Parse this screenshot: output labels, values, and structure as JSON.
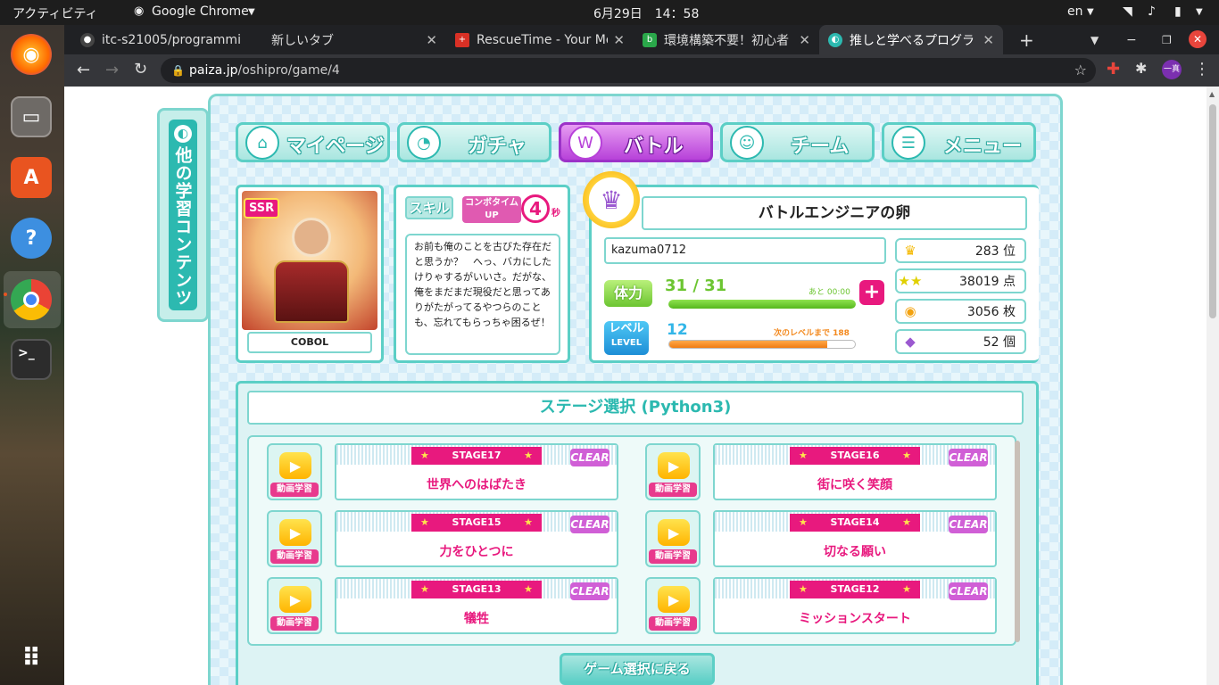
{
  "os": {
    "activities": "アクティビティ",
    "app_name": "Google Chrome",
    "clock": "6月29日　14：58",
    "lang": "en"
  },
  "browser": {
    "tabs": [
      {
        "title": "itc-s21005/programmi"
      },
      {
        "title": "新しいタブ"
      },
      {
        "title": "RescueTime - Your Mo"
      },
      {
        "title": "環境構築不要！初心者"
      },
      {
        "title": "推しと学べるプログラ"
      }
    ],
    "url_host": "paiza.jp",
    "url_path": "/oshipro/game/4",
    "profile": "一真"
  },
  "game": {
    "side_label": "他の学習コンテンツ",
    "nav": [
      {
        "label": "マイページ"
      },
      {
        "label": "ガチャ"
      },
      {
        "label": "バトル"
      },
      {
        "label": "チーム"
      },
      {
        "label": "メニュー"
      }
    ],
    "character": {
      "rarity": "SSR",
      "name": "COBOL"
    },
    "skill": {
      "label": "スキル",
      "combo_label": "コンボタイム UP",
      "combo_value": "4",
      "combo_unit": "秒",
      "quote": "お前も俺のことを古びた存在だと思うか？　へっ、バカにしたけりゃするがいいさ。だがな、俺をまだまだ現役だと思ってありがたがってるやつらのことも、忘れてもらっちゃ困るぜ！"
    },
    "profile": {
      "title": "バトルエンジニアの卵",
      "username": "kazuma0712",
      "stamina_label": "体力",
      "stamina": "31 / 31",
      "stamina_fill": 1.0,
      "stamina_note": "あと 00:00",
      "level_label": "レベル",
      "level_sub": "LEVEL",
      "level": "12",
      "level_note": "次のレベルまで 188",
      "level_fill": 0.85
    },
    "stats": [
      {
        "value": "283 位",
        "icon": "crown-icon"
      },
      {
        "value": "38019 点",
        "icon": "stars-icon"
      },
      {
        "value": "3056 枚",
        "icon": "coin-icon"
      },
      {
        "value": "52 個",
        "icon": "gem-icon"
      }
    ],
    "stage_select": {
      "title": "ステージ選択 (Python3)",
      "video_label": "動画学習",
      "clear_label": "CLEAR",
      "stages": [
        {
          "no": "STAGE17",
          "name": "世界へのはばたき"
        },
        {
          "no": "STAGE16",
          "name": "街に咲く笑顔"
        },
        {
          "no": "STAGE15",
          "name": "力をひとつに"
        },
        {
          "no": "STAGE14",
          "name": "切なる願い"
        },
        {
          "no": "STAGE13",
          "name": "犠牲"
        },
        {
          "no": "STAGE12",
          "name": "ミッションスタート"
        }
      ]
    },
    "back_button": "ゲーム選択に戻る"
  }
}
